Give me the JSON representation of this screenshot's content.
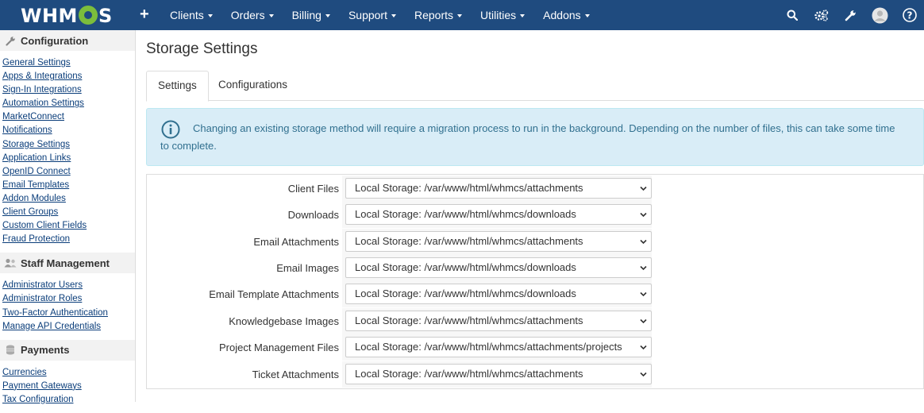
{
  "app": {
    "logo": "WHMCS"
  },
  "topnav": {
    "plus": "+",
    "items": [
      {
        "label": "Clients"
      },
      {
        "label": "Orders"
      },
      {
        "label": "Billing"
      },
      {
        "label": "Support"
      },
      {
        "label": "Reports"
      },
      {
        "label": "Utilities"
      },
      {
        "label": "Addons"
      }
    ],
    "right_icons": [
      "search-icon",
      "gears-icon",
      "wrench-icon",
      "user-avatar-icon",
      "help-icon"
    ]
  },
  "sidebar": {
    "sections": [
      {
        "title": "Configuration",
        "icon": "wrench-icon",
        "links": [
          "General Settings",
          "Apps & Integrations",
          "Sign-In Integrations",
          "Automation Settings",
          "MarketConnect",
          "Notifications",
          "Storage Settings",
          "Application Links",
          "OpenID Connect",
          "Email Templates",
          "Addon Modules",
          "Client Groups",
          "Custom Client Fields",
          "Fraud Protection"
        ]
      },
      {
        "title": "Staff Management",
        "icon": "users-icon",
        "links": [
          "Administrator Users",
          "Administrator Roles",
          "Two-Factor Authentication",
          "Manage API Credentials"
        ]
      },
      {
        "title": "Payments",
        "icon": "coins-icon",
        "links": [
          "Currencies",
          "Payment Gateways",
          "Tax Configuration"
        ]
      }
    ]
  },
  "main": {
    "title": "Storage Settings",
    "tabs": [
      {
        "label": "Settings",
        "active": true
      },
      {
        "label": "Configurations",
        "active": false
      }
    ],
    "alert": {
      "icon": "info-circle-icon",
      "text": "Changing an existing storage method will require a migration process to run in the background. Depending on the number of files, this can take some time to complete."
    },
    "rows": [
      {
        "label": "Client Files",
        "value": "Local Storage: /var/www/html/whmcs/attachments"
      },
      {
        "label": "Downloads",
        "value": "Local Storage: /var/www/html/whmcs/downloads"
      },
      {
        "label": "Email Attachments",
        "value": "Local Storage: /var/www/html/whmcs/attachments"
      },
      {
        "label": "Email Images",
        "value": "Local Storage: /var/www/html/whmcs/downloads"
      },
      {
        "label": "Email Template Attachments",
        "value": "Local Storage: /var/www/html/whmcs/downloads"
      },
      {
        "label": "Knowledgebase Images",
        "value": "Local Storage: /var/www/html/whmcs/attachments"
      },
      {
        "label": "Project Management Files",
        "value": "Local Storage: /var/www/html/whmcs/attachments/projects"
      },
      {
        "label": "Ticket Attachments",
        "value": "Local Storage: /var/www/html/whmcs/attachments"
      }
    ]
  },
  "colors": {
    "nav_bg": "#1f4b7f",
    "link": "#0a3d7a",
    "alert_bg": "#d9edf7",
    "alert_text": "#31708f"
  }
}
